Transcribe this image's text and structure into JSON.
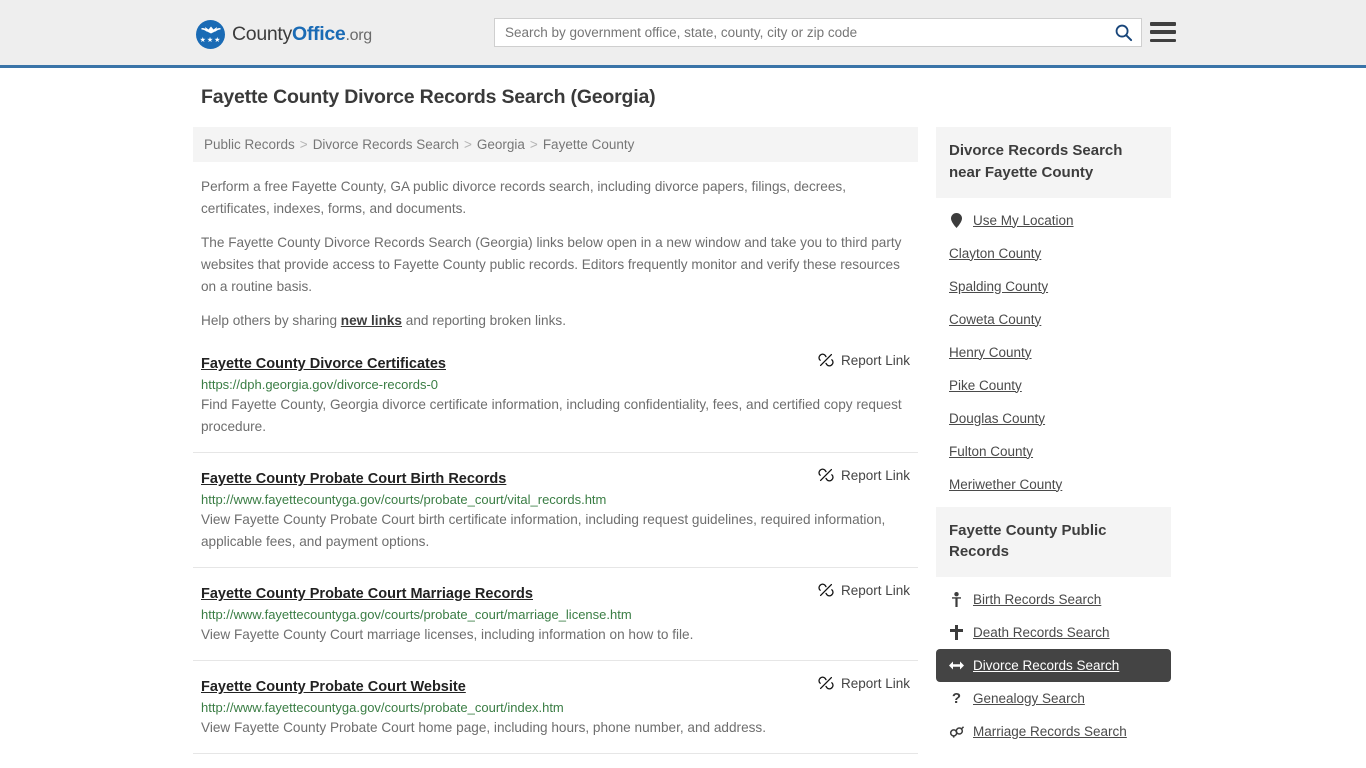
{
  "header": {
    "logo": {
      "part1": "County",
      "part2": "Office",
      "part3": ".org",
      "icon": "eagle-seal-icon"
    },
    "search": {
      "placeholder": "Search by government office, state, county, city or zip code",
      "value": ""
    },
    "search_icon": "search-icon",
    "menu_icon": "hamburger-menu-icon"
  },
  "page": {
    "title": "Fayette County Divorce Records Search (Georgia)"
  },
  "breadcrumb": {
    "separator": ">",
    "items": [
      {
        "label": "Public Records"
      },
      {
        "label": "Divorce Records Search"
      },
      {
        "label": "Georgia"
      },
      {
        "label": "Fayette County"
      }
    ]
  },
  "intro": {
    "p1": "Perform a free Fayette County, GA public divorce records search, including divorce papers, filings, decrees, certificates, indexes, forms, and documents.",
    "p2": "The Fayette County Divorce Records Search (Georgia) links below open in a new window and take you to third party websites that provide access to Fayette County public records. Editors frequently monitor and verify these resources on a routine basis.",
    "p3_before": "Help others by sharing ",
    "p3_link": "new links",
    "p3_after": " and reporting broken links."
  },
  "results": {
    "report_label": "Report Link",
    "report_icon": "broken-link-icon",
    "items": [
      {
        "title": "Fayette County Divorce Certificates",
        "url": "https://dph.georgia.gov/divorce-records-0",
        "desc": "Find Fayette County, Georgia divorce certificate information, including confidentiality, fees, and certified copy request procedure."
      },
      {
        "title": "Fayette County Probate Court Birth Records",
        "url": "http://www.fayettecountyga.gov/courts/probate_court/vital_records.htm",
        "desc": "View Fayette County Probate Court birth certificate information, including request guidelines, required information, applicable fees, and payment options."
      },
      {
        "title": "Fayette County Probate Court Marriage Records",
        "url": "http://www.fayettecountyga.gov/courts/probate_court/marriage_license.htm",
        "desc": "View Fayette County Court marriage licenses, including information on how to file."
      },
      {
        "title": "Fayette County Probate Court Website",
        "url": "http://www.fayettecountyga.gov/courts/probate_court/index.htm",
        "desc": "View Fayette County Probate Court home page, including hours, phone number, and address."
      }
    ]
  },
  "sidebar": {
    "panel1": {
      "heading": "Divorce Records Search near Fayette County",
      "items": [
        {
          "label": "Use My Location",
          "icon": "map-pin-icon",
          "active": false
        },
        {
          "label": "Clayton County",
          "icon": "",
          "active": false
        },
        {
          "label": "Spalding County",
          "icon": "",
          "active": false
        },
        {
          "label": "Coweta County",
          "icon": "",
          "active": false
        },
        {
          "label": "Henry County",
          "icon": "",
          "active": false
        },
        {
          "label": "Pike County",
          "icon": "",
          "active": false
        },
        {
          "label": "Douglas County",
          "icon": "",
          "active": false
        },
        {
          "label": "Fulton County",
          "icon": "",
          "active": false
        },
        {
          "label": "Meriwether County",
          "icon": "",
          "active": false
        }
      ]
    },
    "panel2": {
      "heading": "Fayette County Public Records",
      "items": [
        {
          "label": "Birth Records Search",
          "icon": "baby-icon",
          "active": false
        },
        {
          "label": "Death Records Search",
          "icon": "cross-icon",
          "active": false
        },
        {
          "label": "Divorce Records Search",
          "icon": "left-right-arrow-icon",
          "active": true
        },
        {
          "label": "Genealogy Search",
          "icon": "question-mark-icon",
          "active": false
        },
        {
          "label": "Marriage Records Search",
          "icon": "gender-symbols-icon",
          "active": false
        }
      ]
    }
  },
  "colors": {
    "header_bg": "#eeeeee",
    "header_rule": "#3a74a8",
    "brand_blue": "#1a6bb5",
    "url_green": "#3a7d44",
    "active_bg": "#444444"
  }
}
